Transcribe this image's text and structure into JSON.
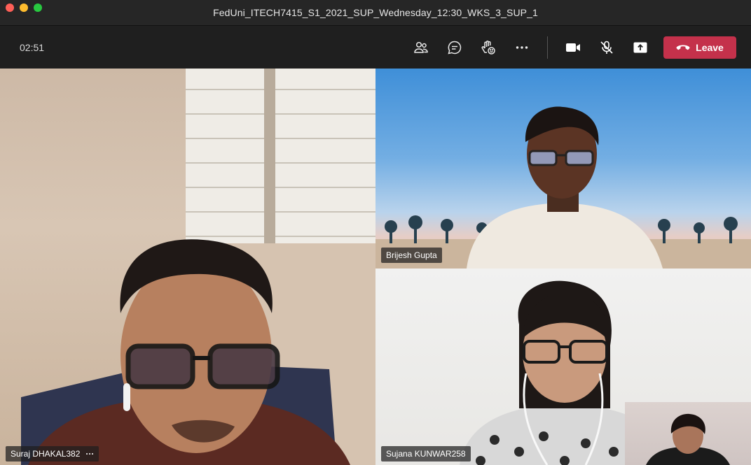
{
  "window": {
    "title": "FedUni_ITECH7415_S1_2021_SUP_Wednesday_12:30_WKS_3_SUP_1"
  },
  "toolbar": {
    "timer": "02:51",
    "icons": [
      "participants-icon",
      "chat-icon",
      "reactions-icon",
      "more-icon",
      "camera-icon",
      "mic-muted-icon",
      "share-icon"
    ],
    "leave_label": "Leave",
    "accent_color": "#c4314b"
  },
  "participants": [
    {
      "name": "Suraj DHAKAL382",
      "tile": "main",
      "more": "···"
    },
    {
      "name": "Brijesh Gupta",
      "tile": "top-right"
    },
    {
      "name": "Sujana KUNWAR258",
      "tile": "bottom-right"
    },
    {
      "name": "",
      "tile": "self-view"
    }
  ]
}
